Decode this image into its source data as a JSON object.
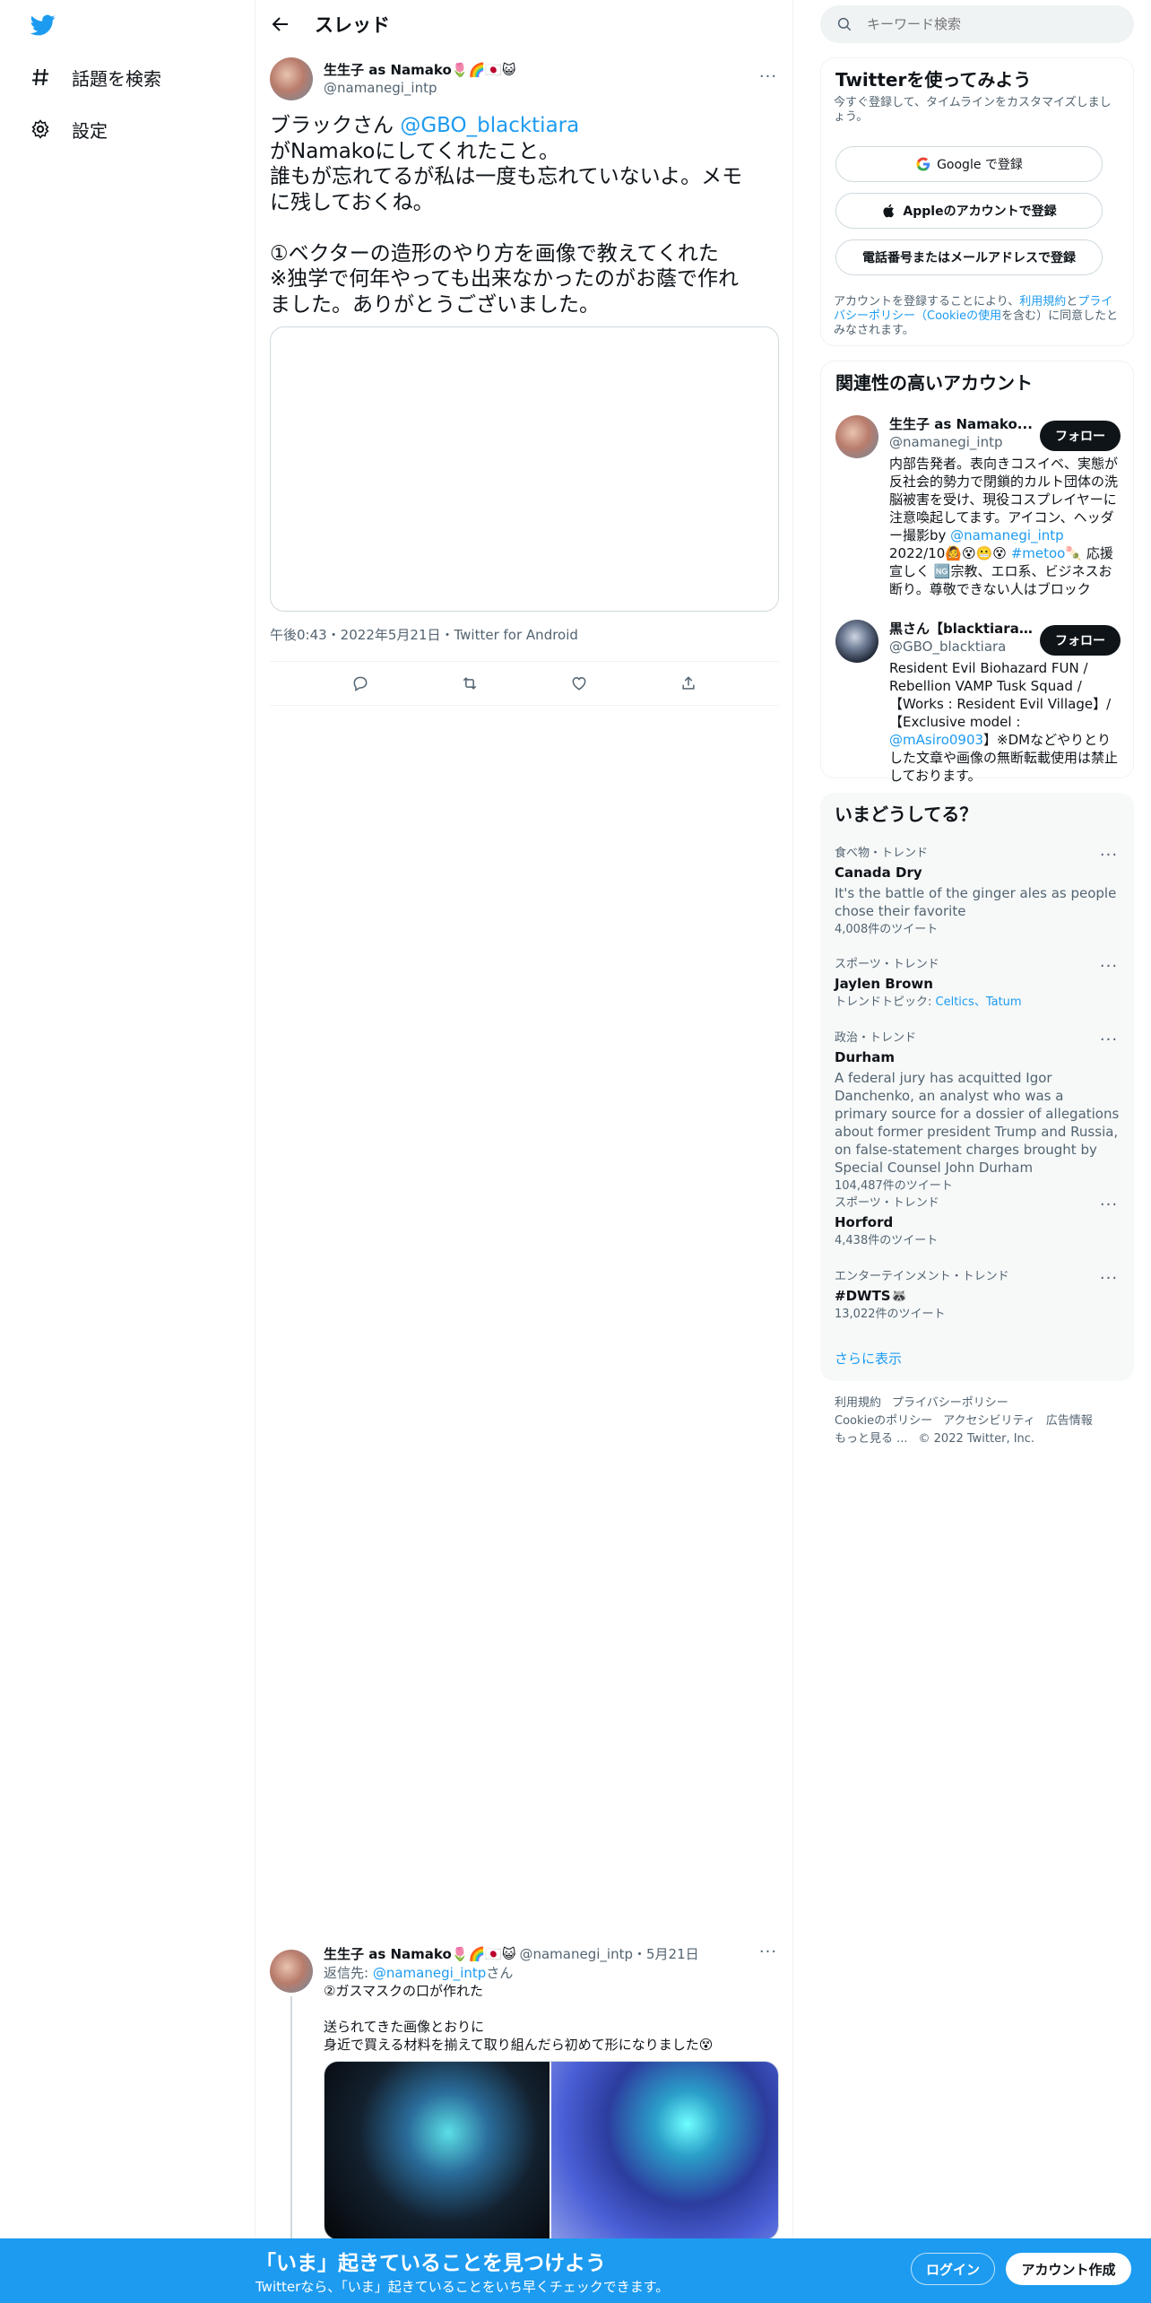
{
  "nav": {
    "explore_label": "話題を検索",
    "settings_label": "設定"
  },
  "header": {
    "title": "スレッド"
  },
  "tweet": {
    "name": "生生子 as Namako🌷🌈🇯🇵😺",
    "handle": "@namanegi_intp",
    "line1_prefix": "ブラックさん ",
    "line1_mention": "@GBO_blacktiara",
    "lines": [
      "がNamakoにしてくれたこと。",
      "誰もが忘れてるが私は一度も忘れていないよ。メモ",
      "に残しておくね。",
      "",
      "①ベクターの造形のやり方を画像で教えてくれた",
      "※独学で何年やっても出来なかったのがお蔭で作れ",
      "ました。ありがとうございました。"
    ],
    "meta": "午後0:43・2022年5月21日・Twitter for Android"
  },
  "reply": {
    "name": "生生子 as Namako🌷🌈🇯🇵😺",
    "handle": "@namanegi_intp",
    "date": "・5月21日",
    "reply_to_prefix": "返信先: ",
    "reply_to_handle": "@namanegi_intp",
    "reply_to_suffix": "さん",
    "lines": [
      "②ガスマスクの口が作れた",
      "",
      "送られてきた画像とおりに",
      "身近で買える材料を揃えて取り組んだら初めて形になりました😵"
    ]
  },
  "search": {
    "placeholder": "キーワード検索"
  },
  "signup": {
    "title": "Twitterを使ってみよう",
    "subtitle": "今すぐ登録して、タイムラインをカスタマイズしましょう。",
    "google": "Google で登録",
    "apple": "Appleのアカウントで登録",
    "phone": "電話番号またはメールアドレスで登録",
    "legal_1": "アカウントを登録することにより、",
    "legal_terms": "利用規約",
    "legal_2": "と",
    "legal_privacy": "プライバシーポリシー（Cookieの使用",
    "legal_3": "を含む）に同意したとみなされます。"
  },
  "related": {
    "title": "関連性の高いアカウント",
    "follow_label": "フォロー",
    "accounts": [
      {
        "name": "生生子 as Namako...",
        "handle": "@namanegi_intp",
        "bio_1": "内部告発者。表向きコスイベ、実態が反社会的勢力で閉鎖的カルト団体の洗脳被害を受け、現役コスプレイヤーに注意喚起してます。アイコン、ヘッダー撮影by ",
        "bio_link1": "@namanegi_intp",
        "bio_2": " 2022/10🙆😵😬😵 ",
        "bio_link2": "#metoo",
        "bio_3": "🍡 応援宣しく 🆖宗教、エロ系、ビジネスお断り。尊敬できない人はブロック"
      },
      {
        "name": "黒さん【blacktiara st...",
        "handle": "@GBO_blacktiara",
        "bio_1": "Resident Evil Biohazard FUN / Rebellion VAMP Tusk Squad / 【Works : Resident Evil Village】/【Exclusive model : ",
        "bio_link1": "@mAsiro0903",
        "bio_2": "】※DMなどやりとりした文章や画像の無断転載使用は禁止しております。"
      }
    ]
  },
  "trends": {
    "title": "いまどうしてる？",
    "items": [
      {
        "context": "食べ物・トレンド",
        "name": "Canada Dry",
        "desc": "It's the battle of the ginger ales as people chose their favorite",
        "count": "4,008件のツイート"
      },
      {
        "context": "スポーツ・トレンド",
        "name": "Jaylen Brown",
        "topics_prefix": "トレンドトピック: ",
        "topics": "Celtics、Tatum"
      },
      {
        "context": "政治・トレンド",
        "name": "Durham",
        "desc": "A federal jury has acquitted Igor Danchenko, an analyst who was a primary source for a dossier of allegations about former president Trump and Russia, on false-statement charges brought by Special Counsel John Durham",
        "count": "104,487件のツイート"
      },
      {
        "context": "スポーツ・トレンド",
        "name": "Horford",
        "count": "4,438件のツイート"
      },
      {
        "context": "エンターテインメント・トレンド",
        "name": "#DWTS🦝",
        "count": "13,022件のツイート"
      }
    ],
    "show_more": "さらに表示"
  },
  "footer": {
    "terms": "利用規約",
    "privacy": "プライバシーポリシー",
    "cookie": "Cookieのポリシー",
    "accessibility": "アクセシビリティ",
    "ads": "広告情報",
    "more": "もっと見る ...",
    "copyright": "© 2022 Twitter, Inc."
  },
  "bottombar": {
    "title": "「いま」起きていることを見つけよう",
    "subtitle": "Twitterなら、「いま」起きていることをいち早くチェックできます。",
    "login": "ログイン",
    "signup": "アカウント作成"
  },
  "colors": {
    "accent": "#1d9bf0",
    "text": "#0f1419",
    "muted": "#536471"
  }
}
